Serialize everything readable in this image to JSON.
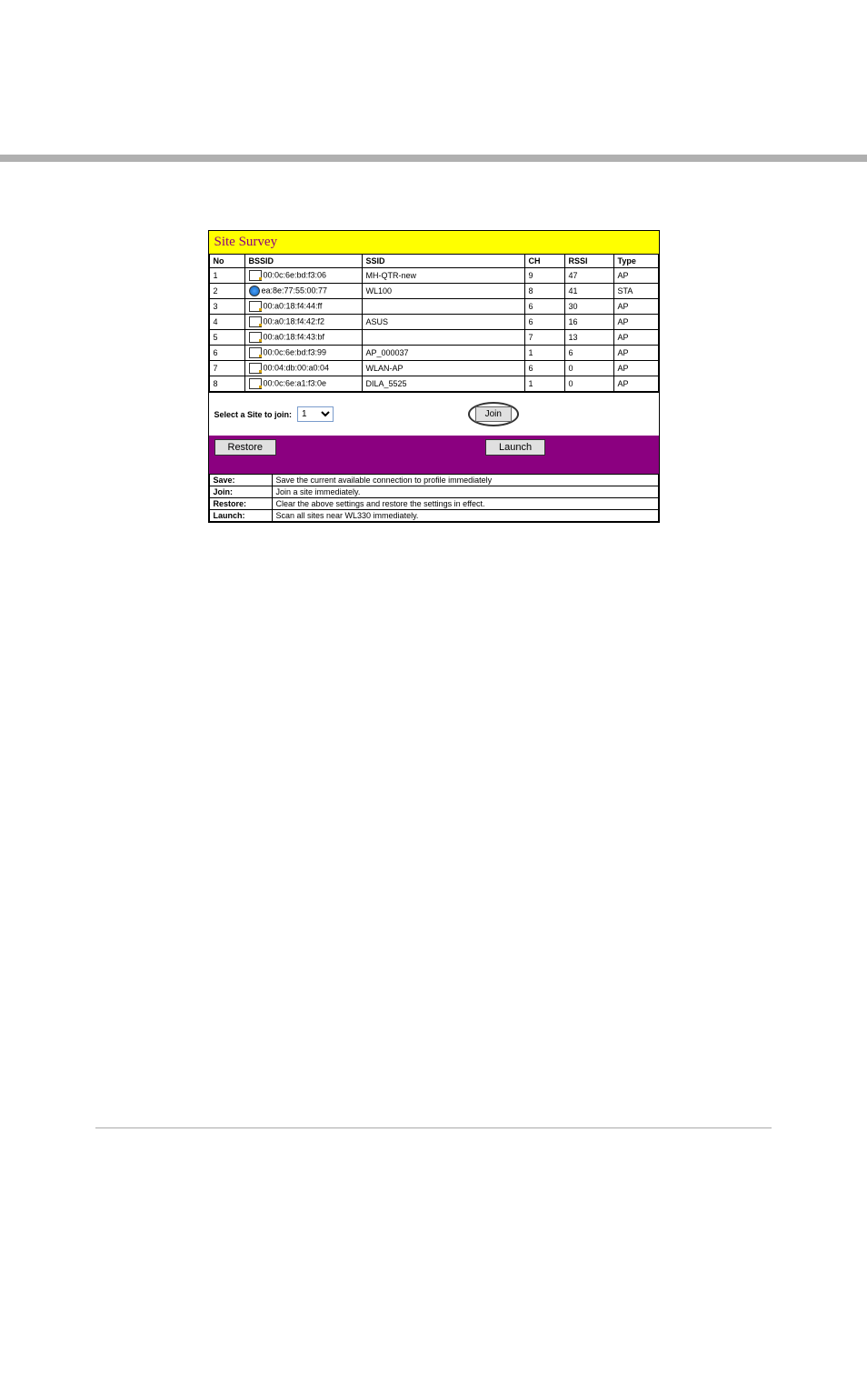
{
  "title": "Site Survey",
  "headers": {
    "no": "No",
    "bssid": "BSSID",
    "ssid": "SSID",
    "ch": "CH",
    "rssi": "RSSI",
    "type": "Type"
  },
  "rows": [
    {
      "no": "1",
      "bssid": "00:0c:6e:bd:f3:06",
      "ssid": "MH-QTR-new",
      "ch": "9",
      "rssi": "47",
      "type": "AP",
      "icon": "ap"
    },
    {
      "no": "2",
      "bssid": "ea:8e:77:55:00:77",
      "ssid": "WL100",
      "ch": "8",
      "rssi": "41",
      "type": "STA",
      "icon": "sta"
    },
    {
      "no": "3",
      "bssid": "00:a0:18:f4:44:ff",
      "ssid": "",
      "ch": "6",
      "rssi": "30",
      "type": "AP",
      "icon": "ap"
    },
    {
      "no": "4",
      "bssid": "00:a0:18:f4:42:f2",
      "ssid": "ASUS",
      "ch": "6",
      "rssi": "16",
      "type": "AP",
      "icon": "ap"
    },
    {
      "no": "5",
      "bssid": "00:a0:18:f4:43:bf",
      "ssid": "",
      "ch": "7",
      "rssi": "13",
      "type": "AP",
      "icon": "ap"
    },
    {
      "no": "6",
      "bssid": "00:0c:6e:bd:f3:99",
      "ssid": "AP_000037",
      "ch": "1",
      "rssi": "6",
      "type": "AP",
      "icon": "ap"
    },
    {
      "no": "7",
      "bssid": "00:04:db:00:a0:04",
      "ssid": "WLAN-AP",
      "ch": "6",
      "rssi": "0",
      "type": "AP",
      "icon": "ap"
    },
    {
      "no": "8",
      "bssid": "00:0c:6e:a1:f3:0e",
      "ssid": "DILA_5525",
      "ch": "1",
      "rssi": "0",
      "type": "AP",
      "icon": "ap"
    }
  ],
  "select": {
    "label": "Select a Site to join:",
    "value": "1",
    "button": "Join"
  },
  "actions": {
    "restore": "Restore",
    "launch": "Launch"
  },
  "descriptions": [
    {
      "label": "Save:",
      "text": "Save the current available connection to profile immediately"
    },
    {
      "label": "Join:",
      "text": "Join a site immediately."
    },
    {
      "label": "Restore:",
      "text": "Clear the above settings and restore the settings in effect."
    },
    {
      "label": "Launch:",
      "text": "Scan all sites near WL330 immediately."
    }
  ]
}
